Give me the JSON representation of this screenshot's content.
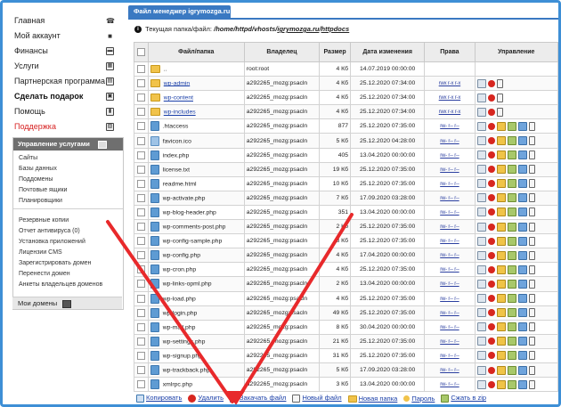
{
  "nav": [
    {
      "label": "Главная",
      "icon": "phone-icon"
    },
    {
      "label": "Мой аккаунт",
      "icon": "user-icon"
    },
    {
      "label": "Финансы",
      "icon": "wallet-icon"
    },
    {
      "label": "Услуги",
      "icon": "services-icon"
    },
    {
      "label": "Партнерская программа",
      "icon": "partner-icon"
    },
    {
      "label": "Сделать подарок",
      "icon": "gift-icon"
    },
    {
      "label": "Помощь",
      "icon": "help-icon"
    },
    {
      "label": "Поддержка",
      "icon": "support-icon"
    }
  ],
  "services_panel": {
    "title": "Управление услугами",
    "group1": [
      "Сайты",
      "Базы данных",
      "Поддомены",
      "Почтовые ящики",
      "Планировщики"
    ],
    "group2": [
      "Резервные копии",
      "Отчет антивируса (0)",
      "Установка приложений",
      "Лицензии CMS",
      "Зарегистрировать домен",
      "Перенести домен",
      "Анкеты владельцев доменов"
    ],
    "my_domains": "Мои домены"
  },
  "fm": {
    "tab": "Файл менеджер igrymozga.ru",
    "path_label": "Текущая папка/файл:",
    "path_prefix": "/home/httpd/vhosts/",
    "path_link1": "igrymozga.ru",
    "path_sep": "/",
    "path_link2": "httpdocs",
    "headers": {
      "name": "Файл/папка",
      "owner": "Владелец",
      "size": "Размер",
      "date": "Дата изменения",
      "perms": "Права",
      "manage": "Управление"
    },
    "rows": [
      {
        "type": "up",
        "name": "..",
        "owner": "root:root",
        "size": "4 Кб",
        "date": "14.07.2019 00:00:00",
        "perms": "",
        "link": false
      },
      {
        "type": "folder",
        "name": "wp-admin",
        "owner": "a292265_mozg:psacln",
        "size": "4 Кб",
        "date": "25.12.2020 07:34:00",
        "perms": "rwx r-x r-x",
        "link": true
      },
      {
        "type": "folder",
        "name": "wp-content",
        "owner": "a292265_mozg:psacln",
        "size": "4 Кб",
        "date": "25.12.2020 07:34:00",
        "perms": "rwx r-x r-x",
        "link": true
      },
      {
        "type": "folder",
        "name": "wp-includes",
        "owner": "a292265_mozg:psacln",
        "size": "4 Кб",
        "date": "25.12.2020 07:34:00",
        "perms": "rwx r-x r-x",
        "link": true
      },
      {
        "type": "ht",
        "name": ".htaccess",
        "owner": "a292265_mozg:psacln",
        "size": "877",
        "date": "25.12.2020 07:35:00",
        "perms": "rw- r-- r--",
        "link": false
      },
      {
        "type": "ico",
        "name": "favicon.ico",
        "owner": "a292265_mozg:psacln",
        "size": "5 Кб",
        "date": "25.12.2020 04:28:00",
        "perms": "rw- r-- r--",
        "link": false
      },
      {
        "type": "php",
        "name": "index.php",
        "owner": "a292265_mozg:psacln",
        "size": "405",
        "date": "13.04.2020 00:00:00",
        "perms": "rw- r-- r--",
        "link": false
      },
      {
        "type": "txt",
        "name": "license.txt",
        "owner": "a292265_mozg:psacln",
        "size": "19 Кб",
        "date": "25.12.2020 07:35:00",
        "perms": "rw- r-- r--",
        "link": false
      },
      {
        "type": "html",
        "name": "readme.html",
        "owner": "a292265_mozg:psacln",
        "size": "10 Кб",
        "date": "25.12.2020 07:35:00",
        "perms": "rw- r-- r--",
        "link": false
      },
      {
        "type": "php",
        "name": "wp-activate.php",
        "owner": "a292265_mozg:psacln",
        "size": "7 Кб",
        "date": "17.09.2020 03:28:00",
        "perms": "rw- r-- r--",
        "link": false
      },
      {
        "type": "php",
        "name": "wp-blog-header.php",
        "owner": "a292265_mozg:psacln",
        "size": "351",
        "date": "13.04.2020 00:00:00",
        "perms": "rw- r-- r--",
        "link": false
      },
      {
        "type": "php",
        "name": "wp-comments-post.php",
        "owner": "a292265_mozg:psacln",
        "size": "2 Кб",
        "date": "25.12.2020 07:35:00",
        "perms": "rw- r-- r--",
        "link": false
      },
      {
        "type": "php",
        "name": "wp-config-sample.php",
        "owner": "a292265_mozg:psacln",
        "size": "3 Кб",
        "date": "25.12.2020 07:35:00",
        "perms": "rw- r-- r--",
        "link": false
      },
      {
        "type": "php",
        "name": "wp-config.php",
        "owner": "a292265_mozg:psacln",
        "size": "4 Кб",
        "date": "17.04.2020 00:00:00",
        "perms": "rw- r-- r--",
        "link": false
      },
      {
        "type": "php",
        "name": "wp-cron.php",
        "owner": "a292265_mozg:psacln",
        "size": "4 Кб",
        "date": "25.12.2020 07:35:00",
        "perms": "rw- r-- r--",
        "link": false
      },
      {
        "type": "php",
        "name": "wp-links-opml.php",
        "owner": "a292265_mozg:psacln",
        "size": "2 Кб",
        "date": "13.04.2020 00:00:00",
        "perms": "rw- r-- r--",
        "link": false
      },
      {
        "type": "php",
        "name": "wp-load.php",
        "owner": "a292265_mozg:psacln",
        "size": "4 Кб",
        "date": "25.12.2020 07:35:00",
        "perms": "rw- r-- r--",
        "link": false
      },
      {
        "type": "php",
        "name": "wp-login.php",
        "owner": "a292265_mozg:psacln",
        "size": "49 Кб",
        "date": "25.12.2020 07:35:00",
        "perms": "rw- r-- r--",
        "link": false
      },
      {
        "type": "php",
        "name": "wp-mail.php",
        "owner": "a292265_mozg:psacln",
        "size": "8 Кб",
        "date": "30.04.2020 00:00:00",
        "perms": "rw- r-- r--",
        "link": false
      },
      {
        "type": "php",
        "name": "wp-settings.php",
        "owner": "a292265_mozg:psacln",
        "size": "21 Кб",
        "date": "25.12.2020 07:35:00",
        "perms": "rw- r-- r--",
        "link": false
      },
      {
        "type": "php",
        "name": "wp-signup.php",
        "owner": "a292265_mozg:psacln",
        "size": "31 Кб",
        "date": "25.12.2020 07:35:00",
        "perms": "rw- r-- r--",
        "link": false
      },
      {
        "type": "php",
        "name": "wp-trackback.php",
        "owner": "a292265_mozg:psacln",
        "size": "5 Кб",
        "date": "17.09.2020 03:28:00",
        "perms": "rw- r-- r--",
        "link": false
      },
      {
        "type": "php",
        "name": "xmlrpc.php",
        "owner": "a292265_mozg:psacln",
        "size": "3 Кб",
        "date": "13.04.2020 00:00:00",
        "perms": "rw- r-- r--",
        "link": false
      }
    ],
    "toolbar": [
      {
        "label": "Копировать",
        "icon": "copy-icon",
        "cls": "copy"
      },
      {
        "label": "Удалить",
        "icon": "delete-icon",
        "cls": "del"
      },
      {
        "label": "Закачать файл",
        "icon": "upload-icon",
        "cls": "upl"
      },
      {
        "label": "Новый файл",
        "icon": "new-file-icon",
        "cls": "new"
      },
      {
        "label": "Новая папка",
        "icon": "new-folder-icon",
        "cls": "fold"
      },
      {
        "label": "Пароль",
        "icon": "key-icon",
        "cls": "key"
      },
      {
        "label": "Сжать в zip",
        "icon": "zip-icon",
        "cls": "zip"
      }
    ]
  },
  "colors": {
    "frame": "#3e8fd6",
    "tab": "#3a79c2",
    "arrow": "#e8292b",
    "link": "#1a3fa8",
    "support": "#d61f1f"
  }
}
